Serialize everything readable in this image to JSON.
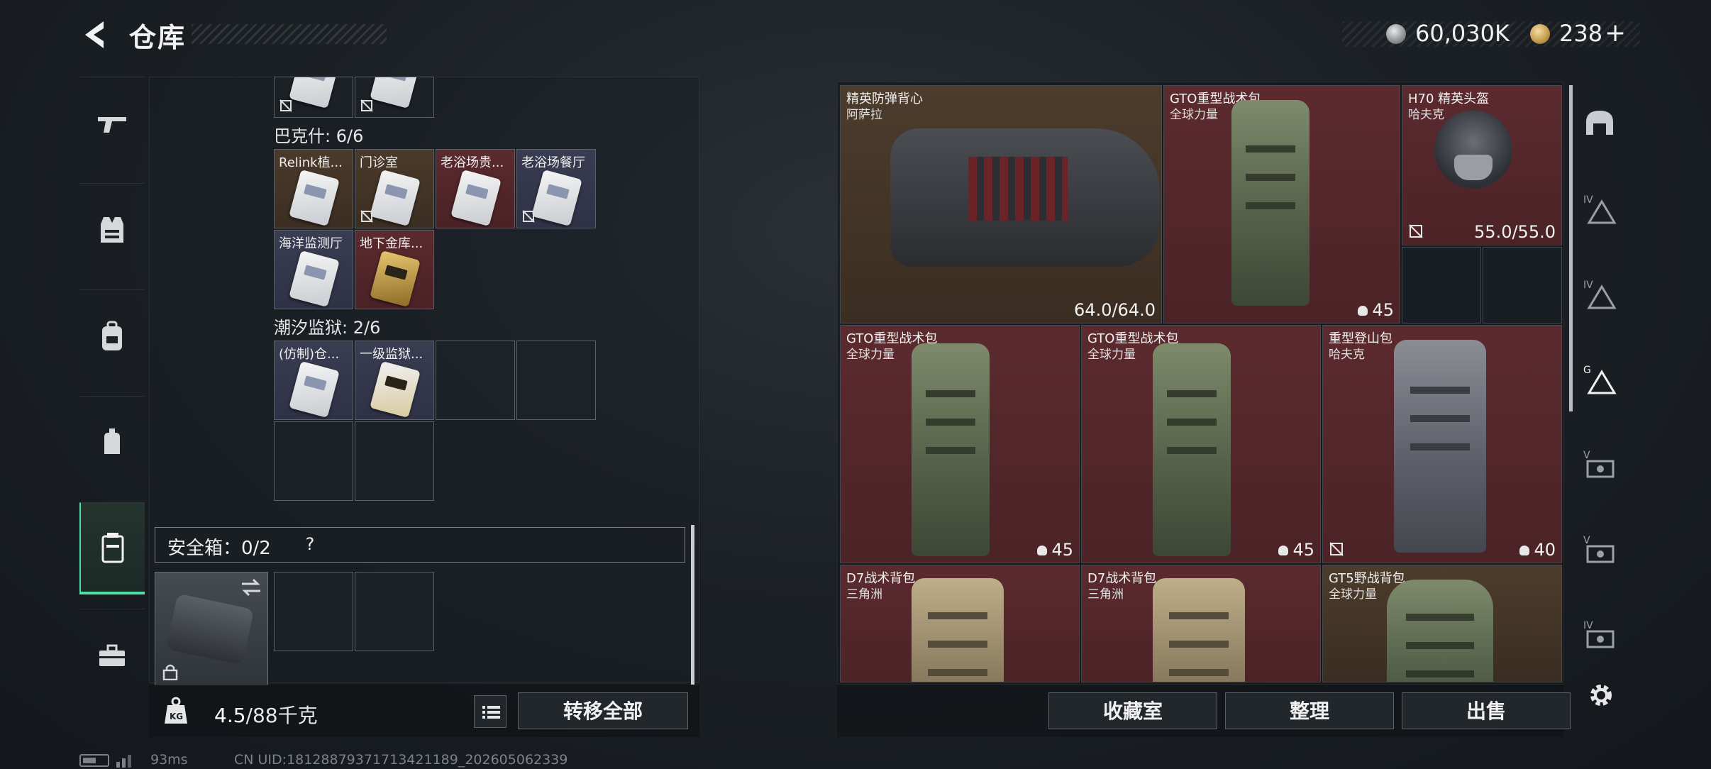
{
  "header": {
    "title": "仓库",
    "currency_silver": "60,030K",
    "currency_gold": "238",
    "plus": "+"
  },
  "nav": {
    "items": [
      "gun-icon",
      "vest-icon",
      "backpack-icon",
      "pouch-icon",
      "container-icon",
      "toolbox-icon"
    ],
    "active_index": 4
  },
  "stash": {
    "sections": [
      {
        "label": "巴克什: 6/6",
        "cells": [
          {
            "label": "Relink植...",
            "color": "brown"
          },
          {
            "label": "门诊室",
            "color": "brown"
          },
          {
            "label": "老浴场贵...",
            "color": "red"
          },
          {
            "label": "老浴场餐厅",
            "color": "blue"
          },
          {
            "label": "海洋监测厅",
            "color": "blue"
          },
          {
            "label": "地下金库...",
            "color": "red"
          }
        ]
      },
      {
        "label": "潮汐监狱: 2/6",
        "cells": [
          {
            "label": "(仿制)仓...",
            "color": "blue"
          },
          {
            "label": "一级监狱...",
            "color": "blue"
          }
        ]
      }
    ],
    "safe_box_label": "安全箱：0/2",
    "help_label": "?",
    "weight_current": "4.5",
    "weight_total": "/88千克",
    "transfer_label": "转移全部"
  },
  "equipment": {
    "items": [
      {
        "name": "精英防弹背心",
        "sub": "阿萨拉",
        "value": "64.0/64.0",
        "color": "brown"
      },
      {
        "name": "GTO重型战术包",
        "sub": "全球力量",
        "capacity": "45",
        "color": "red"
      },
      {
        "name": "H70 精英头盔",
        "sub": "哈夫克",
        "value": "55.0/55.0",
        "color": "red"
      },
      {
        "name": "GTO重型战术包",
        "sub": "全球力量",
        "capacity": "45",
        "color": "red"
      },
      {
        "name": "GTO重型战术包",
        "sub": "全球力量",
        "capacity": "45",
        "color": "red"
      },
      {
        "name": "重型登山包",
        "sub": "哈夫克",
        "capacity": "40",
        "color": "red"
      },
      {
        "name": "D7战术背包",
        "sub": "三角洲",
        "color": "red"
      },
      {
        "name": "D7战术背包",
        "sub": "三角洲",
        "color": "red"
      },
      {
        "name": "GT5野战背包",
        "sub": "全球力量",
        "color": "brown"
      }
    ],
    "buttons": {
      "collection": "收藏室",
      "organize": "整理",
      "sell": "出售"
    }
  },
  "right_rail": {
    "items": [
      "helmet-rack-icon",
      "tier-iv-icon",
      "tier-iv-icon",
      "tier-g-icon",
      "tier-v-icon",
      "tier-v-icon",
      "tier-iv-icon"
    ],
    "labels": [
      "",
      "IV",
      "IV",
      "G",
      "V",
      "V",
      "IV"
    ]
  },
  "status": {
    "ping": "93ms",
    "uid": "CN UID:18128879371713421189_202605062339"
  },
  "colors": {
    "accent": "#4de1a6",
    "red_rarity": "#5b2a2f",
    "brown_rarity": "#4c3c2c",
    "blue_rarity": "#3a3d52"
  }
}
